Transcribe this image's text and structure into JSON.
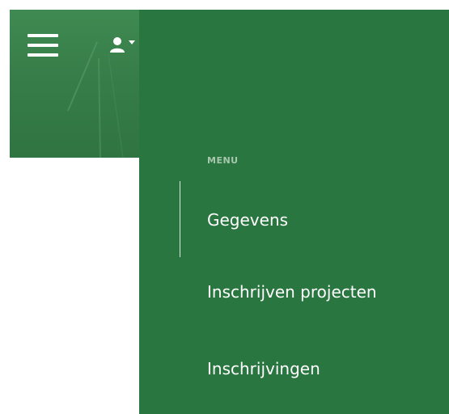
{
  "header": {
    "menu_toggle_icon": "hamburger-icon",
    "user_icon": "user-icon",
    "user_dropdown_icon": "caret-down-icon",
    "banner_color": "#377d49"
  },
  "menu": {
    "heading": "MENU",
    "panel_color": "#2a7640",
    "heading_color": "#a8c7ae",
    "items": [
      {
        "label": "Gegevens",
        "active": true
      },
      {
        "label": "Inschrijven projecten",
        "active": false
      },
      {
        "label": "Inschrijvingen",
        "active": false
      }
    ]
  }
}
